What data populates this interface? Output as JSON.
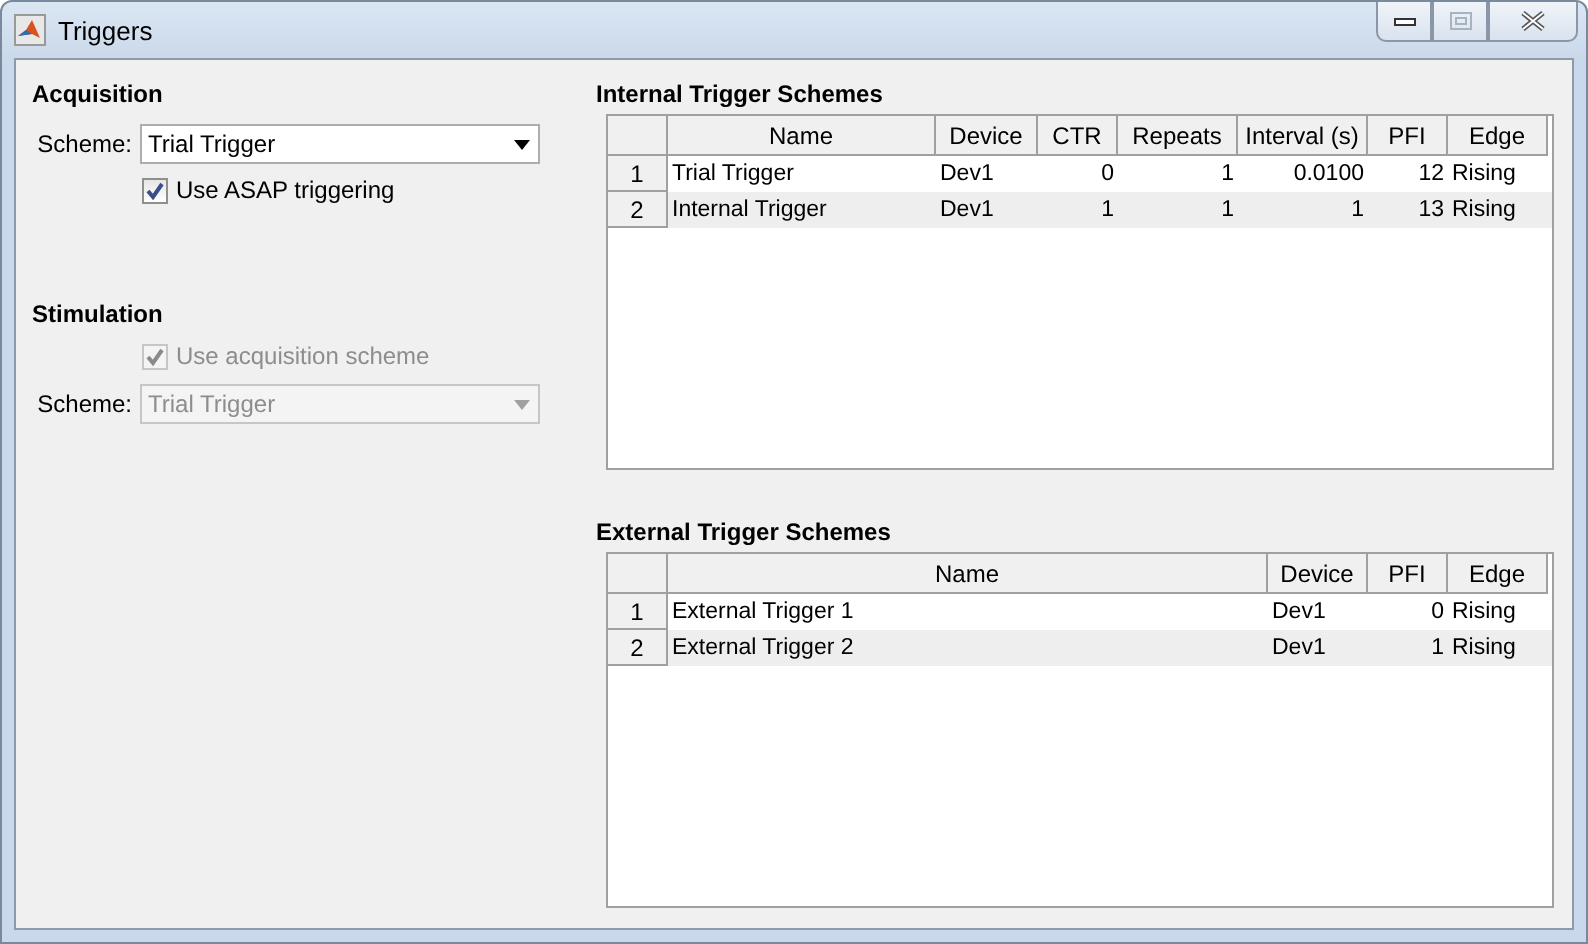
{
  "window": {
    "title": "Triggers"
  },
  "acquisition": {
    "heading": "Acquisition",
    "scheme_label": "Scheme:",
    "scheme_value": "Trial Trigger",
    "scheme_disabled": false,
    "asap": {
      "label": "Use ASAP triggering",
      "checked": true,
      "disabled": false
    }
  },
  "stimulation": {
    "heading": "Stimulation",
    "use_acq": {
      "label": "Use acquisition scheme",
      "checked": true,
      "disabled": true
    },
    "scheme_label": "Scheme:",
    "scheme_value": "Trial Trigger",
    "scheme_disabled": true
  },
  "internal": {
    "title": "Internal Trigger Schemes",
    "columns": [
      {
        "label": "Name",
        "kind": "text"
      },
      {
        "label": "Device",
        "kind": "text"
      },
      {
        "label": "CTR",
        "kind": "number"
      },
      {
        "label": "Repeats",
        "kind": "number"
      },
      {
        "label": "Interval (s)",
        "kind": "number"
      },
      {
        "label": "PFI",
        "kind": "number"
      },
      {
        "label": "Edge",
        "kind": "text"
      }
    ],
    "rows": [
      {
        "index": "1",
        "cells": [
          "Trial Trigger",
          "Dev1",
          "0",
          "1",
          "0.0100",
          "12",
          "Rising"
        ]
      },
      {
        "index": "2",
        "cells": [
          "Internal Trigger",
          "Dev1",
          "1",
          "1",
          "1",
          "13",
          "Rising"
        ]
      }
    ]
  },
  "external": {
    "title": "External Trigger Schemes",
    "columns": [
      {
        "label": "Name",
        "kind": "text"
      },
      {
        "label": "Device",
        "kind": "text"
      },
      {
        "label": "PFI",
        "kind": "number"
      },
      {
        "label": "Edge",
        "kind": "text"
      }
    ],
    "rows": [
      {
        "index": "1",
        "cells": [
          "External Trigger 1",
          "Dev1",
          "0",
          "Rising"
        ]
      },
      {
        "index": "2",
        "cells": [
          "External Trigger 2",
          "Dev1",
          "1",
          "Rising"
        ]
      }
    ]
  }
}
